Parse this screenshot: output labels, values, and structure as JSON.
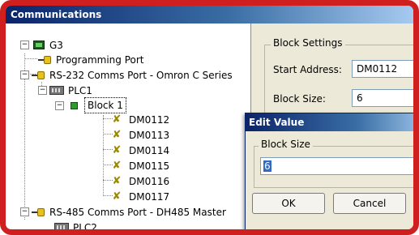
{
  "window": {
    "title": "Communications"
  },
  "tree": {
    "root": "G3",
    "programming_port": "Programming Port",
    "rs232": "RS-232 Comms Port - Omron C Series",
    "plc1": "PLC1",
    "block1": "Block 1",
    "items": [
      "DM0112",
      "DM0113",
      "DM0114",
      "DM0115",
      "DM0116",
      "DM0117"
    ],
    "rs485": "RS-485 Comms Port - DH485 Master",
    "plc2": "PLC2"
  },
  "settings": {
    "group_title": "Block Settings",
    "start_address_label": "Start Address:",
    "start_address_value": "DM0112",
    "block_size_label": "Block Size:",
    "block_size_value": "6"
  },
  "dialog": {
    "title": "Edit Value",
    "group_title": "Block Size",
    "value": "6",
    "ok_label": "OK",
    "cancel_label": "Cancel"
  }
}
